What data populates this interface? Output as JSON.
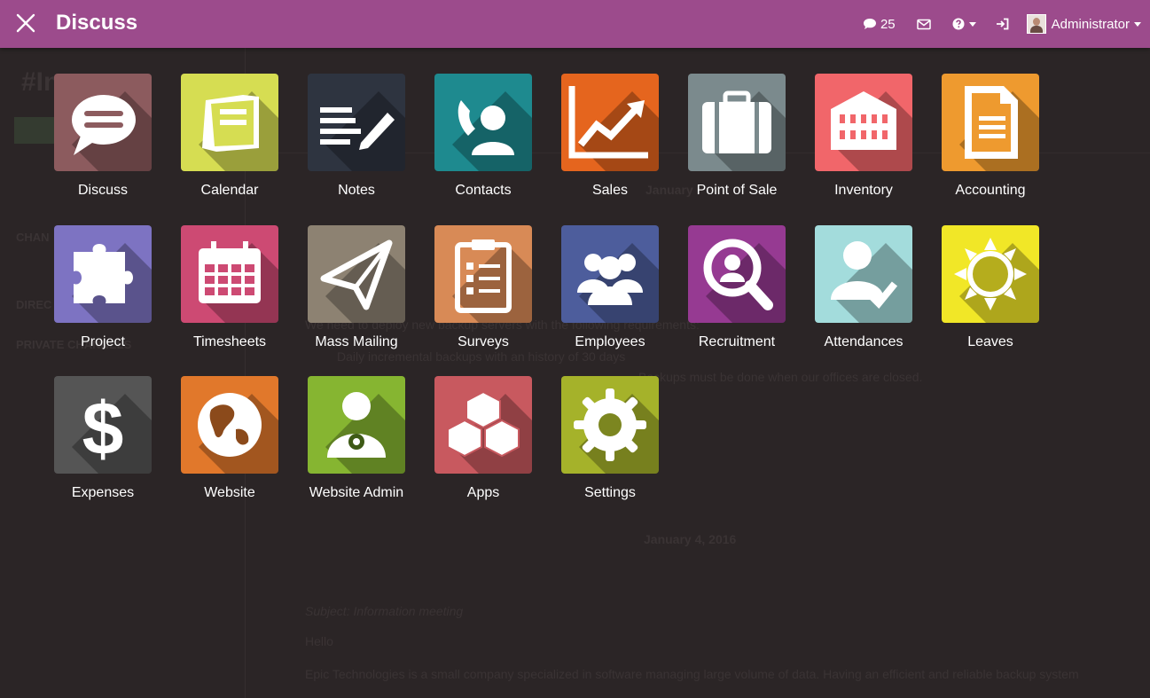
{
  "topbar": {
    "title": "Discuss",
    "chat_count": "25",
    "user_name": "Administrator",
    "color": "#9c4b8c"
  },
  "background": {
    "page_title": "#In",
    "sidebar": [
      "CHAN",
      "DIREC",
      "PRIVATE CHANNELS"
    ],
    "date1": "January",
    "date2": "January 4, 2016",
    "lines": [
      "We need to deploy new backup servers with the following requirements:",
      "Daily incremental backups with an history of 30 days",
      "Backups must be done when our offices are closed.",
      "Subject: Information meeting",
      "Hello",
      "Epic Technologies is a small company specialized in software managing large volume of data. Having an efficient and reliable backup system"
    ]
  },
  "apps": [
    {
      "label": "Discuss",
      "color": "#8c5b5e",
      "icon": "chat-bubble-icon"
    },
    {
      "label": "Calendar",
      "color": "#d6dd52",
      "icon": "calendar-book-icon"
    },
    {
      "label": "Notes",
      "color": "#2e3440",
      "icon": "notes-pencil-icon"
    },
    {
      "label": "Contacts",
      "color": "#1e8a8f",
      "icon": "phone-contact-icon"
    },
    {
      "label": "Sales",
      "color": "#e5651e",
      "icon": "sales-chart-icon"
    },
    {
      "label": "Point of Sale",
      "color": "#7b8a8d",
      "icon": "briefcase-icon"
    },
    {
      "label": "Inventory",
      "color": "#f1666a",
      "icon": "warehouse-icon"
    },
    {
      "label": "Accounting",
      "color": "#ee9a2f",
      "icon": "invoice-document-icon"
    },
    {
      "label": "Project",
      "color": "#7d73c2",
      "icon": "puzzle-icon"
    },
    {
      "label": "Timesheets",
      "color": "#cd4a73",
      "icon": "timesheet-calendar-icon"
    },
    {
      "label": "Mass Mailing",
      "color": "#8d8272",
      "icon": "paper-plane-icon"
    },
    {
      "label": "Surveys",
      "color": "#d88a56",
      "icon": "clipboard-icon"
    },
    {
      "label": "Employees",
      "color": "#4d5d9c",
      "icon": "people-group-icon"
    },
    {
      "label": "Recruitment",
      "color": "#963a92",
      "icon": "magnifier-person-icon"
    },
    {
      "label": "Attendances",
      "color": "#a3dcdc",
      "icon": "person-check-icon"
    },
    {
      "label": "Leaves",
      "color": "#f1e727",
      "icon": "sun-icon"
    },
    {
      "label": "Expenses",
      "color": "#555555",
      "icon": "dollar-icon"
    },
    {
      "label": "Website",
      "color": "#e1782b",
      "icon": "globe-icon"
    },
    {
      "label": "Website Admin",
      "color": "#86b531",
      "icon": "person-gear-icon"
    },
    {
      "label": "Apps",
      "color": "#c8595f",
      "icon": "cubes-icon"
    },
    {
      "label": "Settings",
      "color": "#a5b22a",
      "icon": "gear-icon"
    }
  ]
}
